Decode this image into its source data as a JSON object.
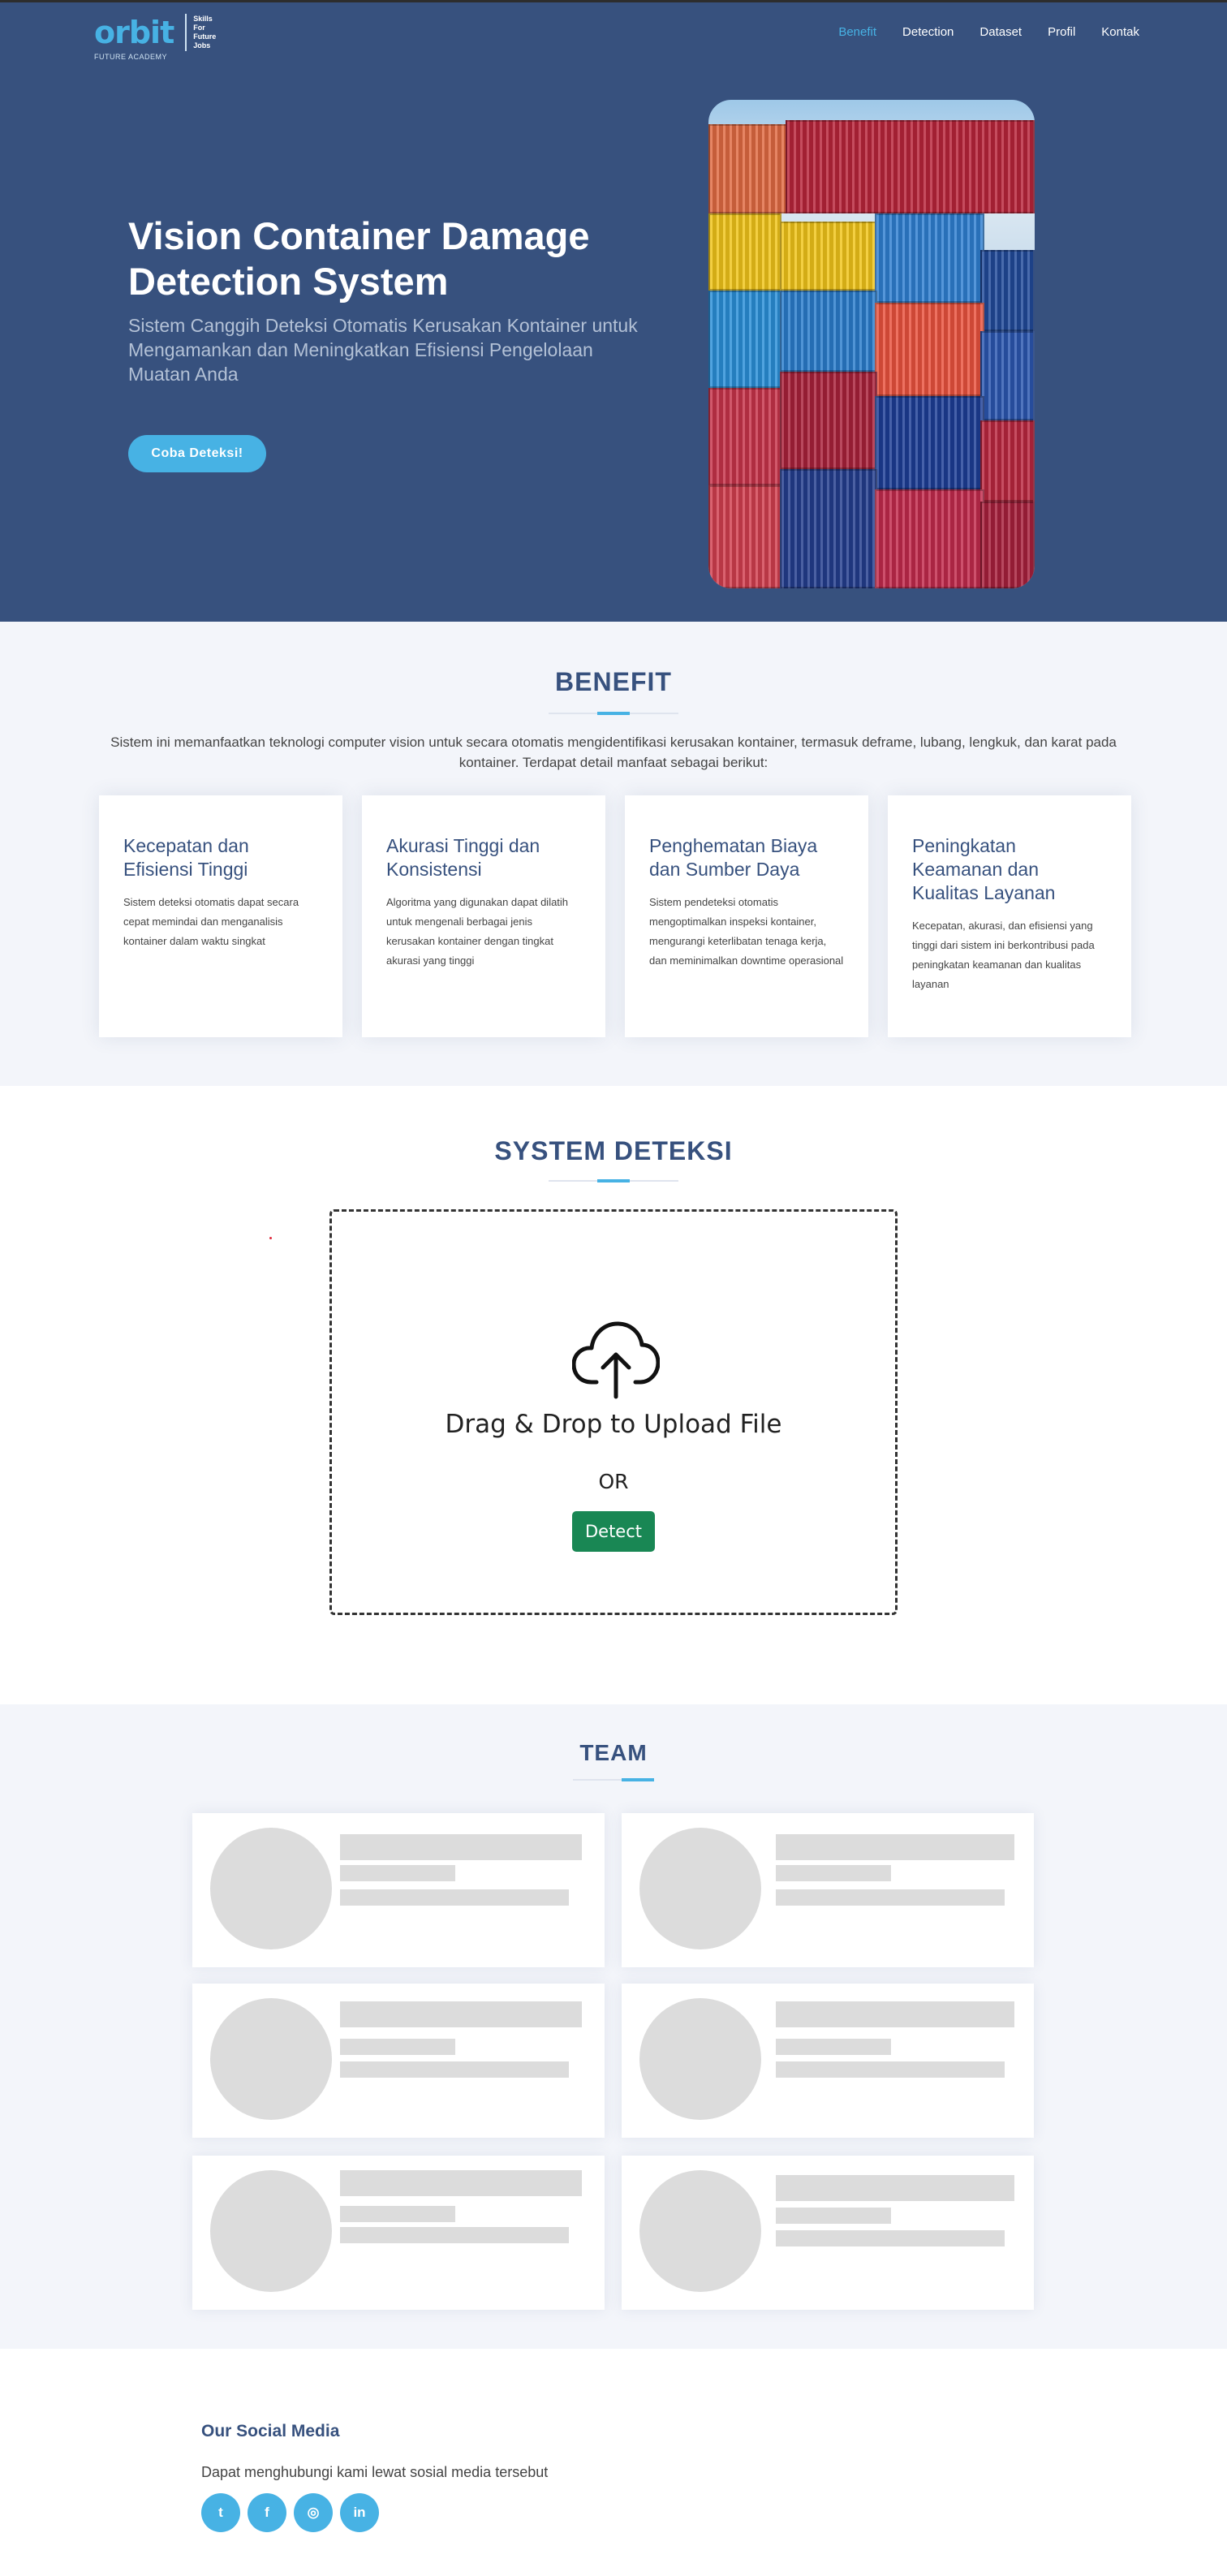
{
  "brand": {
    "logo_text": "orbit",
    "logo_sub": "FUTURE ACADEMY",
    "tagline_1": "Skills",
    "tagline_2": "For",
    "tagline_3": "Future",
    "tagline_4": "Jobs"
  },
  "nav": {
    "items": [
      {
        "label": "Benefit",
        "active": true
      },
      {
        "label": "Detection"
      },
      {
        "label": "Dataset"
      },
      {
        "label": "Profil"
      },
      {
        "label": "Kontak"
      }
    ]
  },
  "hero": {
    "title": "Vision Container Damage Detection System",
    "subtitle": "Sistem Canggih Deteksi Otomatis Kerusakan Kontainer untuk Mengamankan dan Meningkatkan Efisiensi Pengelolaan Muatan Anda",
    "cta": "Coba Deteksi!"
  },
  "benefit": {
    "title": "BENEFIT",
    "description": "Sistem ini memanfaatkan teknologi computer vision untuk secara otomatis mengidentifikasi kerusakan kontainer, termasuk deframe, lubang, lengkuk, dan karat pada kontainer. Terdapat detail manfaat sebagai berikut:",
    "cards": [
      {
        "title": "Kecepatan dan Efisiensi Tinggi",
        "text": "Sistem deteksi otomatis dapat secara cepat memindai dan menganalisis kontainer dalam waktu singkat"
      },
      {
        "title": "Akurasi Tinggi dan Konsistensi",
        "text": "Algoritma yang digunakan dapat dilatih untuk mengenali berbagai jenis kerusakan kontainer dengan tingkat akurasi yang tinggi"
      },
      {
        "title": "Penghematan Biaya dan Sumber Daya",
        "text": "Sistem pendeteksi otomatis mengoptimalkan inspeksi kontainer, mengurangi keterlibatan tenaga kerja, dan meminimalkan downtime operasional"
      },
      {
        "title": "Peningkatan Keamanan dan Kualitas Layanan",
        "text": "Kecepatan, akurasi, dan efisiensi yang tinggi dari sistem ini berkontribusi pada peningkatan keamanan dan kualitas layanan"
      }
    ]
  },
  "system": {
    "title": "SYSTEM DETEKSI",
    "drop_text": "Drag & Drop to Upload File",
    "or_text": "OR",
    "detect_label": "Detect"
  },
  "team": {
    "title": "TEAM"
  },
  "footer": {
    "title": "Our Social Media",
    "description": "Dapat menghubungi kami lewat sosial media tersebut",
    "socials": [
      {
        "icon": "twitter-icon",
        "glyph": "t"
      },
      {
        "icon": "facebook-icon",
        "glyph": "f"
      },
      {
        "icon": "instagram-icon",
        "glyph": "◎"
      },
      {
        "icon": "linkedin-icon",
        "glyph": "in"
      }
    ]
  },
  "colors": {
    "primary": "#37517e",
    "accent": "#47b2e4",
    "detect_button": "#198754"
  }
}
